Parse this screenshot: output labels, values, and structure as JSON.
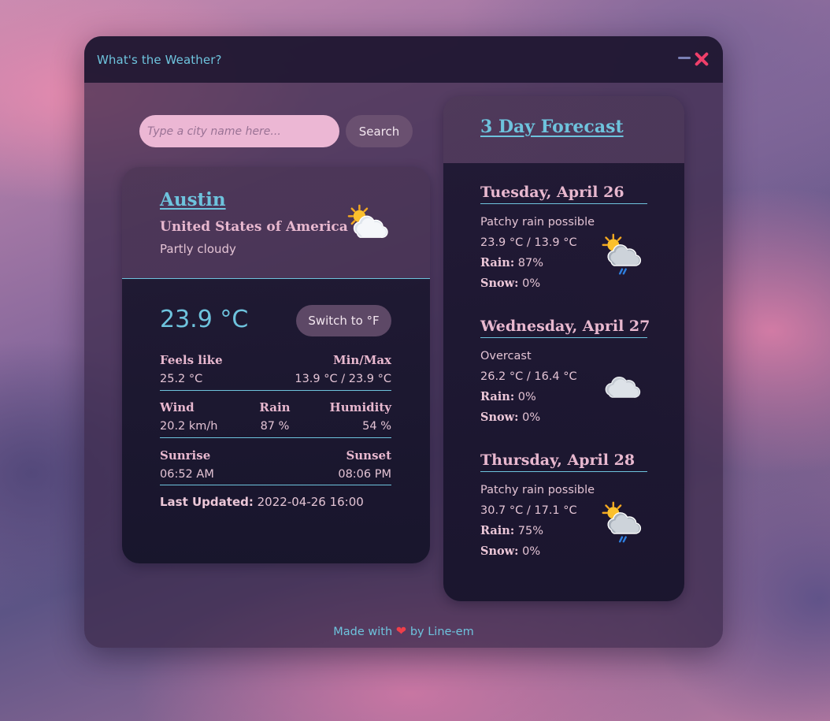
{
  "app": {
    "title": "What's the Weather?"
  },
  "search": {
    "placeholder": "Type a city name here...",
    "value": "",
    "button_label": "Search"
  },
  "current": {
    "city": "Austin",
    "country": "United States of America",
    "condition": "Partly cloudy",
    "icon": "partly-cloudy-icon",
    "temperature": "23.9 °C",
    "switch_label": "Switch to °F",
    "feels_like_label": "Feels like",
    "feels_like": "25.2 °C",
    "minmax_label": "Min/Max",
    "minmax": "13.9 °C / 23.9 °C",
    "wind_label": "Wind",
    "wind": "20.2 km/h",
    "rain_label": "Rain",
    "rain": "87 %",
    "humidity_label": "Humidity",
    "humidity": "54 %",
    "sunrise_label": "Sunrise",
    "sunrise": "06:52 AM",
    "sunset_label": "Sunset",
    "sunset": "08:06 PM",
    "last_updated_label": "Last Updated:",
    "last_updated": "2022-04-26 16:00"
  },
  "forecast": {
    "title": "3 Day Forecast",
    "rain_label": "Rain:",
    "snow_label": "Snow:",
    "days": [
      {
        "date": "Tuesday, April 26",
        "condition": "Patchy rain possible",
        "temps": "23.9 °C / 13.9 °C",
        "rain": "87%",
        "snow": "0%",
        "icon": "patchy-rain-icon"
      },
      {
        "date": "Wednesday, April 27",
        "condition": "Overcast",
        "temps": "26.2 °C / 16.4 °C",
        "rain": "0%",
        "snow": "0%",
        "icon": "overcast-cloud-icon"
      },
      {
        "date": "Thursday, April 28",
        "condition": "Patchy rain possible",
        "temps": "30.7 °C / 17.1 °C",
        "rain": "75%",
        "snow": "0%",
        "icon": "patchy-rain-icon"
      }
    ]
  },
  "footer": {
    "prefix": "Made with",
    "suffix": "by Line-em",
    "icon": "heart-icon"
  },
  "colors": {
    "accent": "#6ec3dd",
    "pink": "#e8b8cf",
    "close": "#ef3f6a",
    "heart": "#ef3f4a"
  }
}
